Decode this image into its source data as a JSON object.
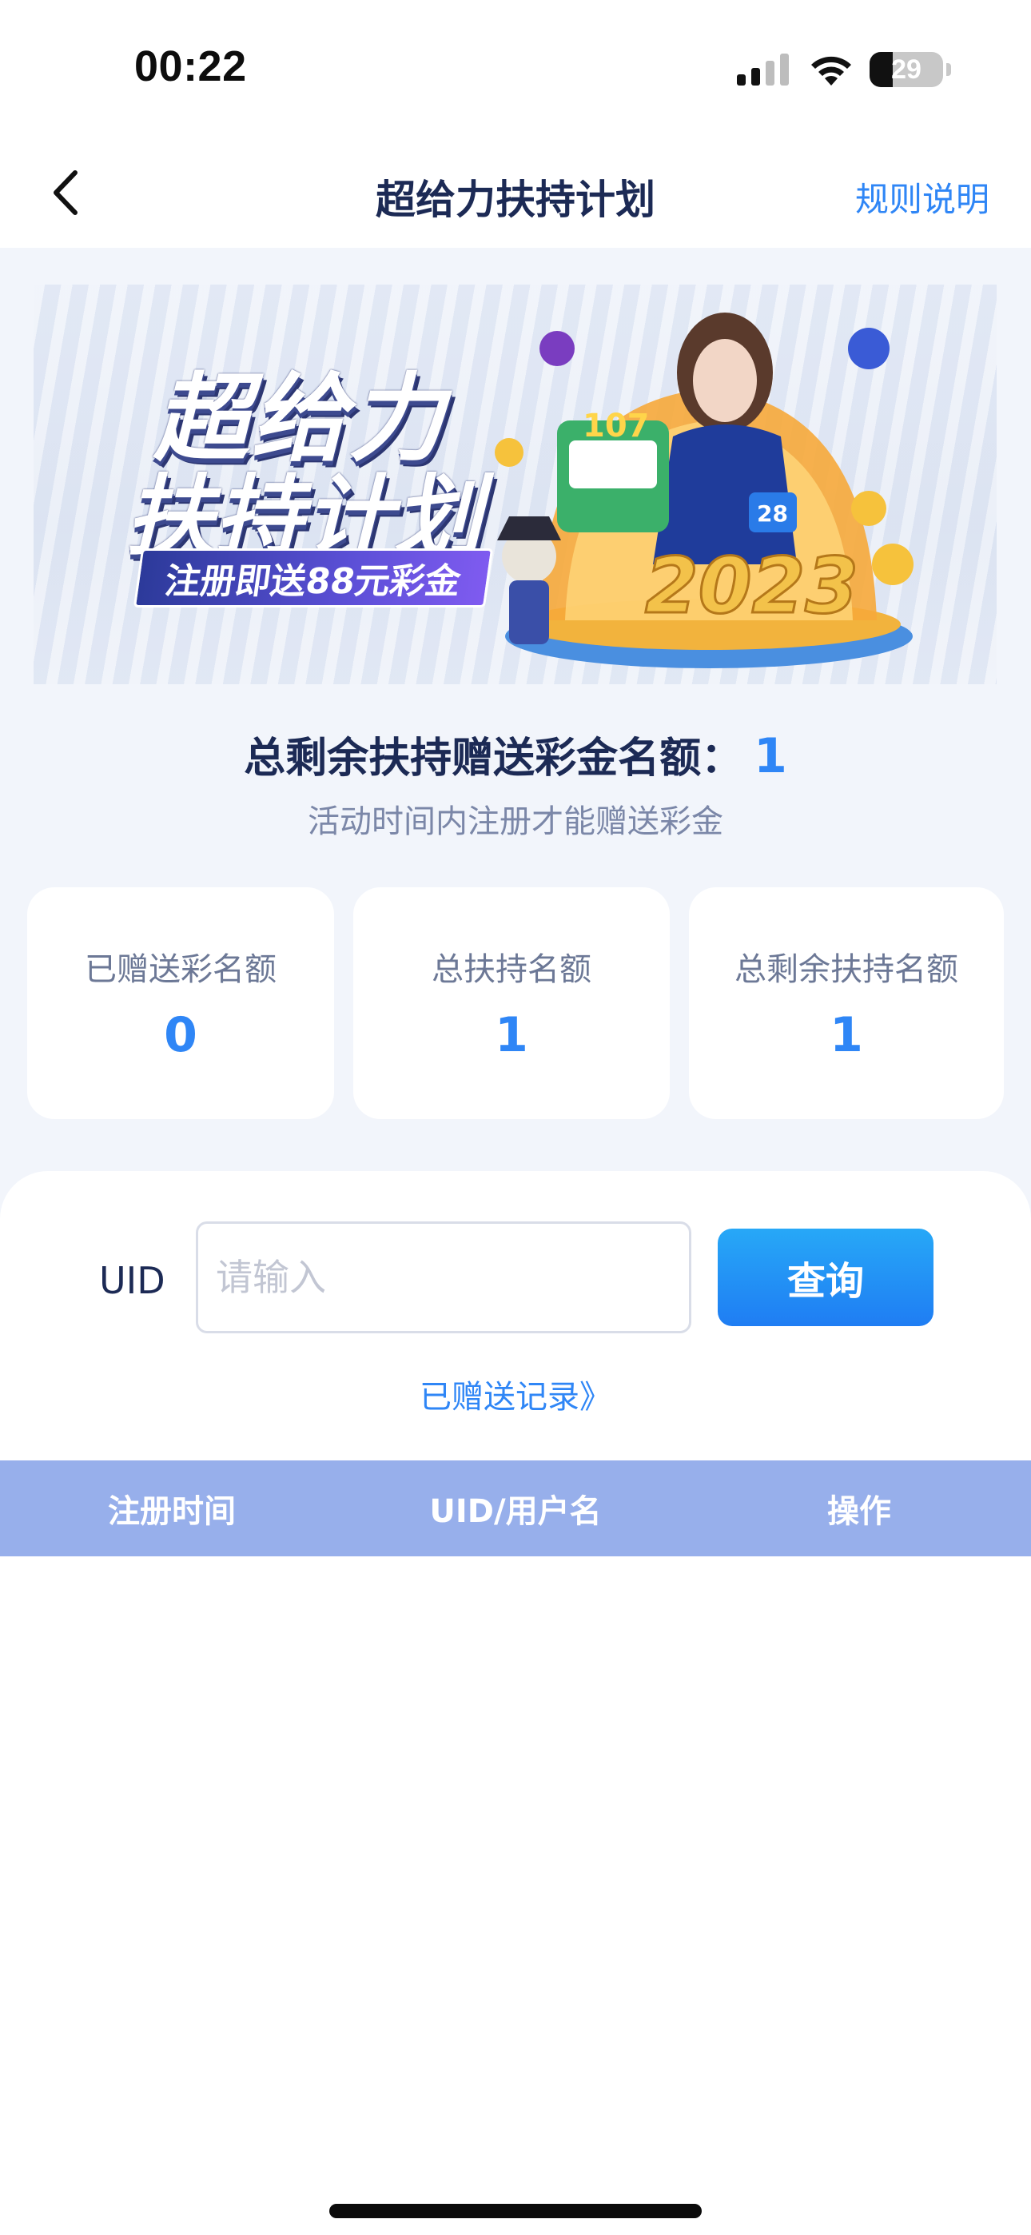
{
  "status_bar": {
    "time": "00:22",
    "battery": "29"
  },
  "nav": {
    "title": "超给力扶持计划",
    "rules_label": "规则说明",
    "back_icon": "chevron-left-icon"
  },
  "banner": {
    "title_line1": "超给力",
    "title_line2": "扶持计划",
    "tagline": "注册即送88元彩金",
    "art_texts": [
      "107",
      "28",
      "2023"
    ]
  },
  "summary": {
    "label": "总剩余扶持赠送彩金名额：",
    "value": "1",
    "note": "活动时间内注册才能赠送彩金"
  },
  "stats": [
    {
      "label": "已赠送彩名额",
      "value": "0"
    },
    {
      "label": "总扶持名额",
      "value": "1"
    },
    {
      "label": "总剩余扶持名额",
      "value": "1"
    }
  ],
  "query": {
    "uid_label": "UID",
    "uid_placeholder": "请输入",
    "uid_value": "",
    "button_label": "查询",
    "records_link": "已赠送记录》"
  },
  "table": {
    "columns": [
      "注册时间",
      "UID/用户名",
      "操作"
    ],
    "rows": []
  },
  "colors": {
    "accent": "#2f86f6",
    "table_header": "#97afeb",
    "page_bg": "#f2f5fb"
  }
}
